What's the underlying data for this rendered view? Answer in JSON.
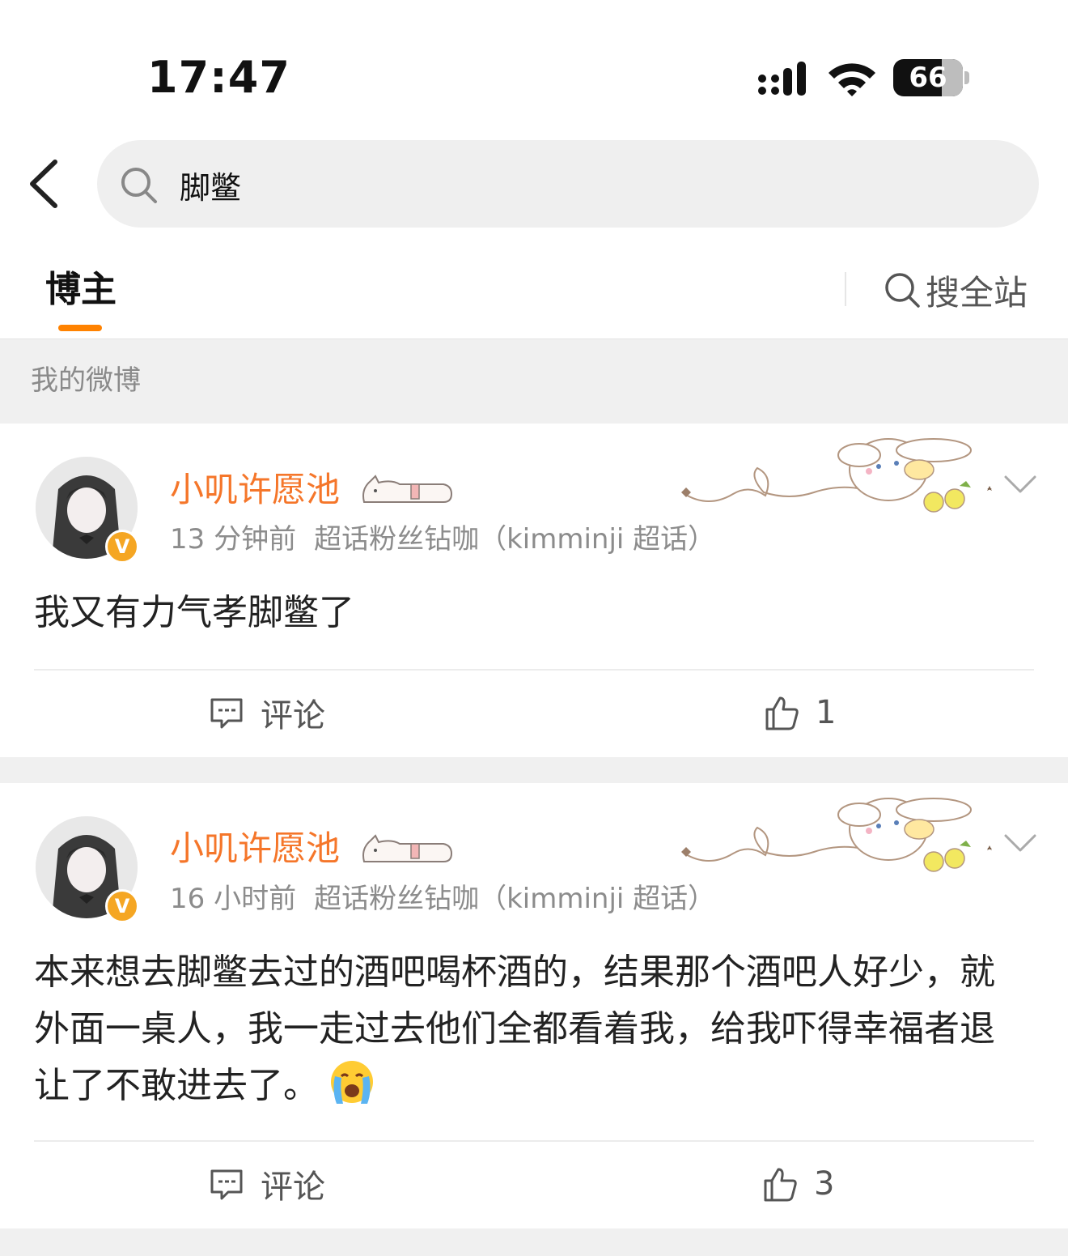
{
  "status_bar": {
    "time": "17:47",
    "battery": "66"
  },
  "search": {
    "query": "脚鳖"
  },
  "tabs": {
    "bloggers": "博主",
    "search_all": "搜全站"
  },
  "section": {
    "title": "我的微博"
  },
  "posts": [
    {
      "username": "小叽许愿池",
      "time": "13 分钟前",
      "source": "超话粉丝钻咖（kimminji 超话）",
      "text": "我又有力气孝脚鳖了",
      "comment_label": "评论",
      "likes": "1",
      "icons": {
        "emoji": "crying-emoji"
      }
    },
    {
      "username": "小叽许愿池",
      "time": "16 小时前",
      "source": "超话粉丝钻咖（kimminji 超话）",
      "text": "本来想去脚鳖去过的酒吧喝杯酒的，结果那个酒吧人好少，就外面一桌人，我一走过去他们全都看着我，给我吓得幸福者退让了不敢进去了。",
      "comment_label": "评论",
      "likes": "3"
    }
  ],
  "colors": {
    "accent": "#ff8200",
    "username": "#f5762a",
    "section_bg": "#f0f0f0"
  }
}
